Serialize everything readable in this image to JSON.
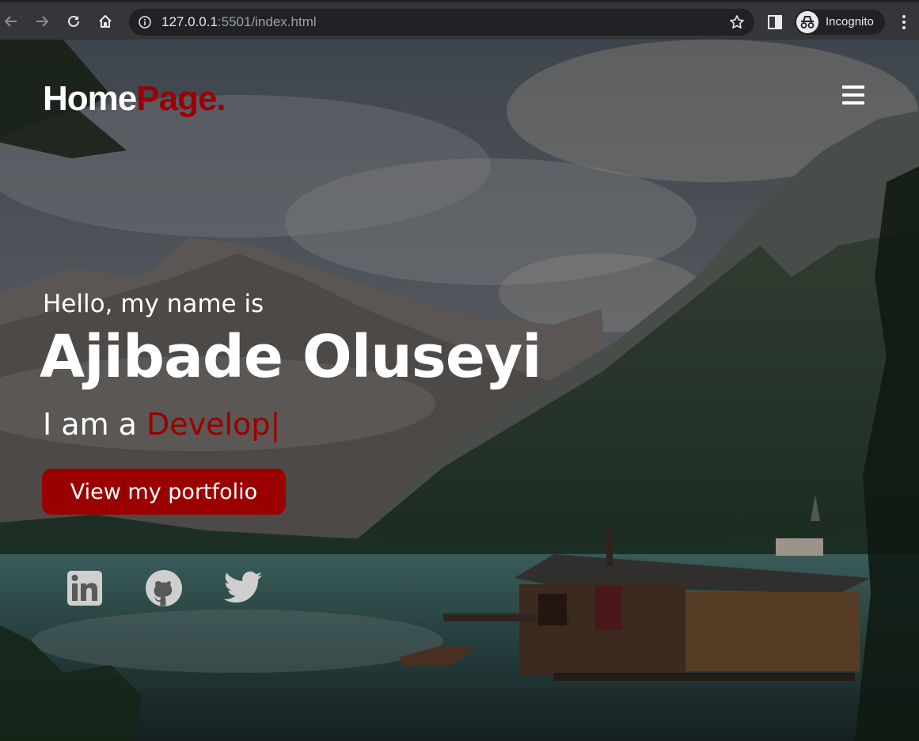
{
  "browser": {
    "url_host": "127.0.0.1",
    "url_rest": ":5501/index.html",
    "profile_label": "Incognito",
    "icons": [
      "back-icon",
      "forward-icon",
      "reload-icon",
      "home-icon",
      "info-icon",
      "star-icon",
      "side-panel-icon",
      "incognito-icon",
      "more-menu-icon"
    ]
  },
  "page": {
    "logo_main": "Home",
    "logo_accent": "Page.",
    "greeting": "Hello, my name is",
    "name": "Ajibade Oluseyi",
    "role_prefix": "I am a ",
    "role_typed": "Develop",
    "cursor": "|",
    "cta_label": "View my portfolio",
    "social": [
      "linkedin-icon",
      "github-icon",
      "twitter-icon"
    ],
    "accent_color": "#9b0000"
  }
}
